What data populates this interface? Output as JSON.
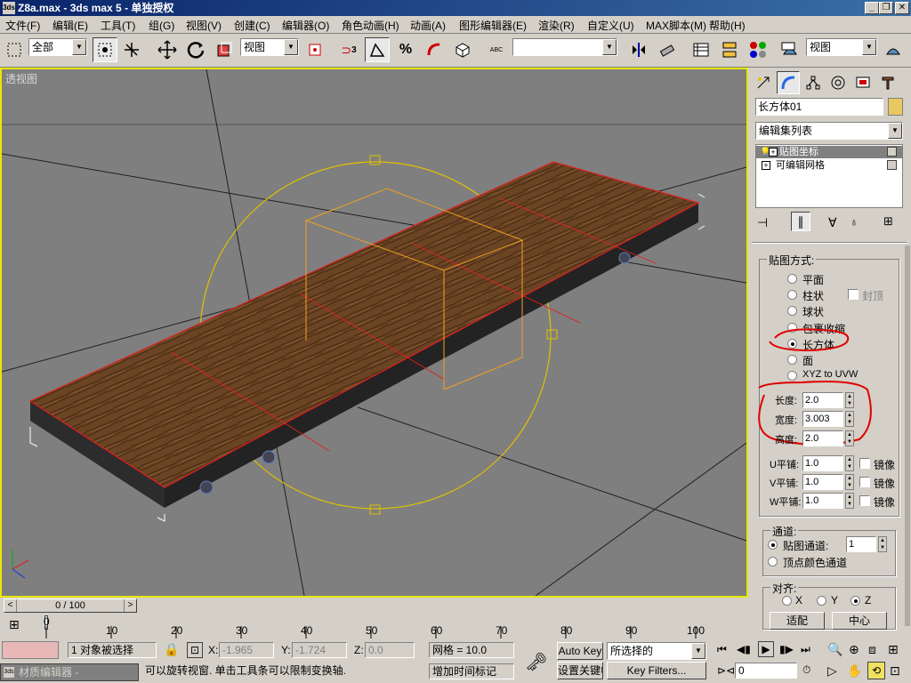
{
  "window": {
    "title": "Z8a.max - 3ds max 5 - 单独授权",
    "app_icon": "max-icon",
    "controls": [
      "_",
      "❐",
      "✕"
    ]
  },
  "menu": [
    "文件(F)",
    "编辑(E)",
    "工具(T)",
    "组(G)",
    "视图(V)",
    "创建(C)",
    "编辑器(O)",
    "角色动画(H)",
    "动画(A)",
    "图形编辑器(E)",
    "渲染(R)",
    "自定义(U)",
    "MAX脚本(M)",
    "帮助(H)"
  ],
  "toolbar": {
    "selection_filter": "全部",
    "ref_coord": "视图",
    "named_selection": "",
    "render_view": "视图",
    "snap_label": "3",
    "percent_label": "%",
    "abc_label": "ABC"
  },
  "viewport": {
    "label": "透视图",
    "accent": "#e8e800"
  },
  "command_panel": {
    "object_name": "长方体01",
    "object_color": "#e8c860",
    "modifier_list": "编辑集列表",
    "stack": [
      "贴图坐标",
      "可编辑网格"
    ],
    "mapping": {
      "group_label": "贴图方式:",
      "options": [
        "平面",
        "柱状",
        "球状",
        "包裹收缩",
        "长方体",
        "面",
        "XYZ to UVW"
      ],
      "selected": "长方体",
      "cap_label": "封顶",
      "length_label": "长度:",
      "length_value": "2.0",
      "width_label": "宽度:",
      "width_value": "3.003",
      "height_label": "高度:",
      "height_value": "2.0",
      "u_label": "U平铺:",
      "u_value": "1.0",
      "v_label": "V平铺:",
      "v_value": "1.0",
      "w_label": "W平铺:",
      "w_value": "1.0",
      "flip_label": "镜像"
    },
    "channel": {
      "group_label": "通道:",
      "map_channel_label": "贴图通道:",
      "map_channel_value": "1",
      "vertex_color_label": "顶点颜色通道"
    },
    "alignment": {
      "group_label": "对齐:",
      "axes": [
        "X",
        "Y",
        "Z"
      ],
      "selected_axis": "Z",
      "fit_button": "适配",
      "center_button": "中心"
    }
  },
  "timeline": {
    "frame_display": "0 / 100",
    "prev": "<",
    "next": ">",
    "ticks": [
      "0",
      "10",
      "20",
      "30",
      "40",
      "50",
      "60",
      "70",
      "80",
      "90",
      "100"
    ]
  },
  "status": {
    "mat_editor": "材质编辑器 -",
    "selection": "1 对象被选择",
    "x_label": "X:",
    "x_value": "-1.965",
    "y_label": "Y:",
    "y_value": "-1.724",
    "z_label": "Z:",
    "z_value": "0.0",
    "grid": "网格 = 10.0",
    "prompt": "可以旋转视窗. 单击工具条可以限制变换轴.",
    "add_time_tag": "增加时间标记",
    "auto_key": "Auto Key",
    "set_key": "设置关键帧",
    "key_selection": "所选择的",
    "key_filters": "Key Filters...",
    "frame_field": "0"
  }
}
